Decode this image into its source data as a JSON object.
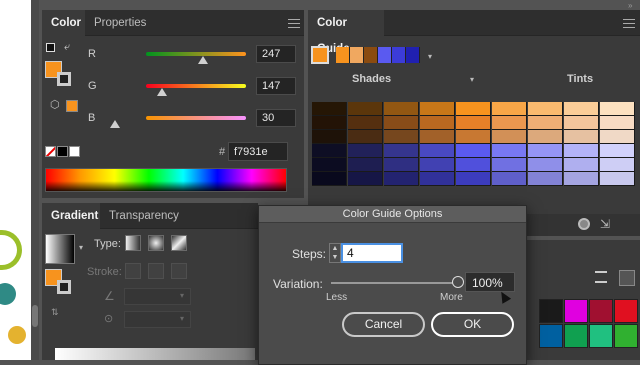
{
  "color_panel": {
    "tabs": [
      "Color",
      "Properties"
    ],
    "sliders": [
      {
        "label": "R",
        "value": "247"
      },
      {
        "label": "G",
        "value": "147"
      },
      {
        "label": "B",
        "value": "30"
      }
    ],
    "hex_label": "#",
    "hex_value": "f7931e",
    "fill_color": "#f7931e"
  },
  "guide_panel": {
    "title": "Color Guide",
    "shades_label": "Shades",
    "tints_label": "Tints",
    "harmony_colors": [
      "#f7931e",
      "#f0a860",
      "#8a4b10",
      "#5a5af0",
      "#3c3cd8",
      "#2020b0"
    ]
  },
  "gradient_panel": {
    "tabs": [
      "Gradient",
      "Transparency"
    ],
    "type_label": "Type:",
    "stroke_label": "Stroke:"
  },
  "dialog": {
    "title": "Color Guide Options",
    "steps_label": "Steps:",
    "steps_value": "4",
    "variation_label": "Variation:",
    "variation_value": "100%",
    "less_label": "Less",
    "more_label": "More",
    "cancel_label": "Cancel",
    "ok_label": "OK"
  },
  "swatches_panel": {
    "colors": [
      "#1a1a1a",
      "#e000e0",
      "#a01030",
      "#e01020",
      "#0060a0",
      "#10a050",
      "#20c080",
      "#30b030"
    ]
  }
}
